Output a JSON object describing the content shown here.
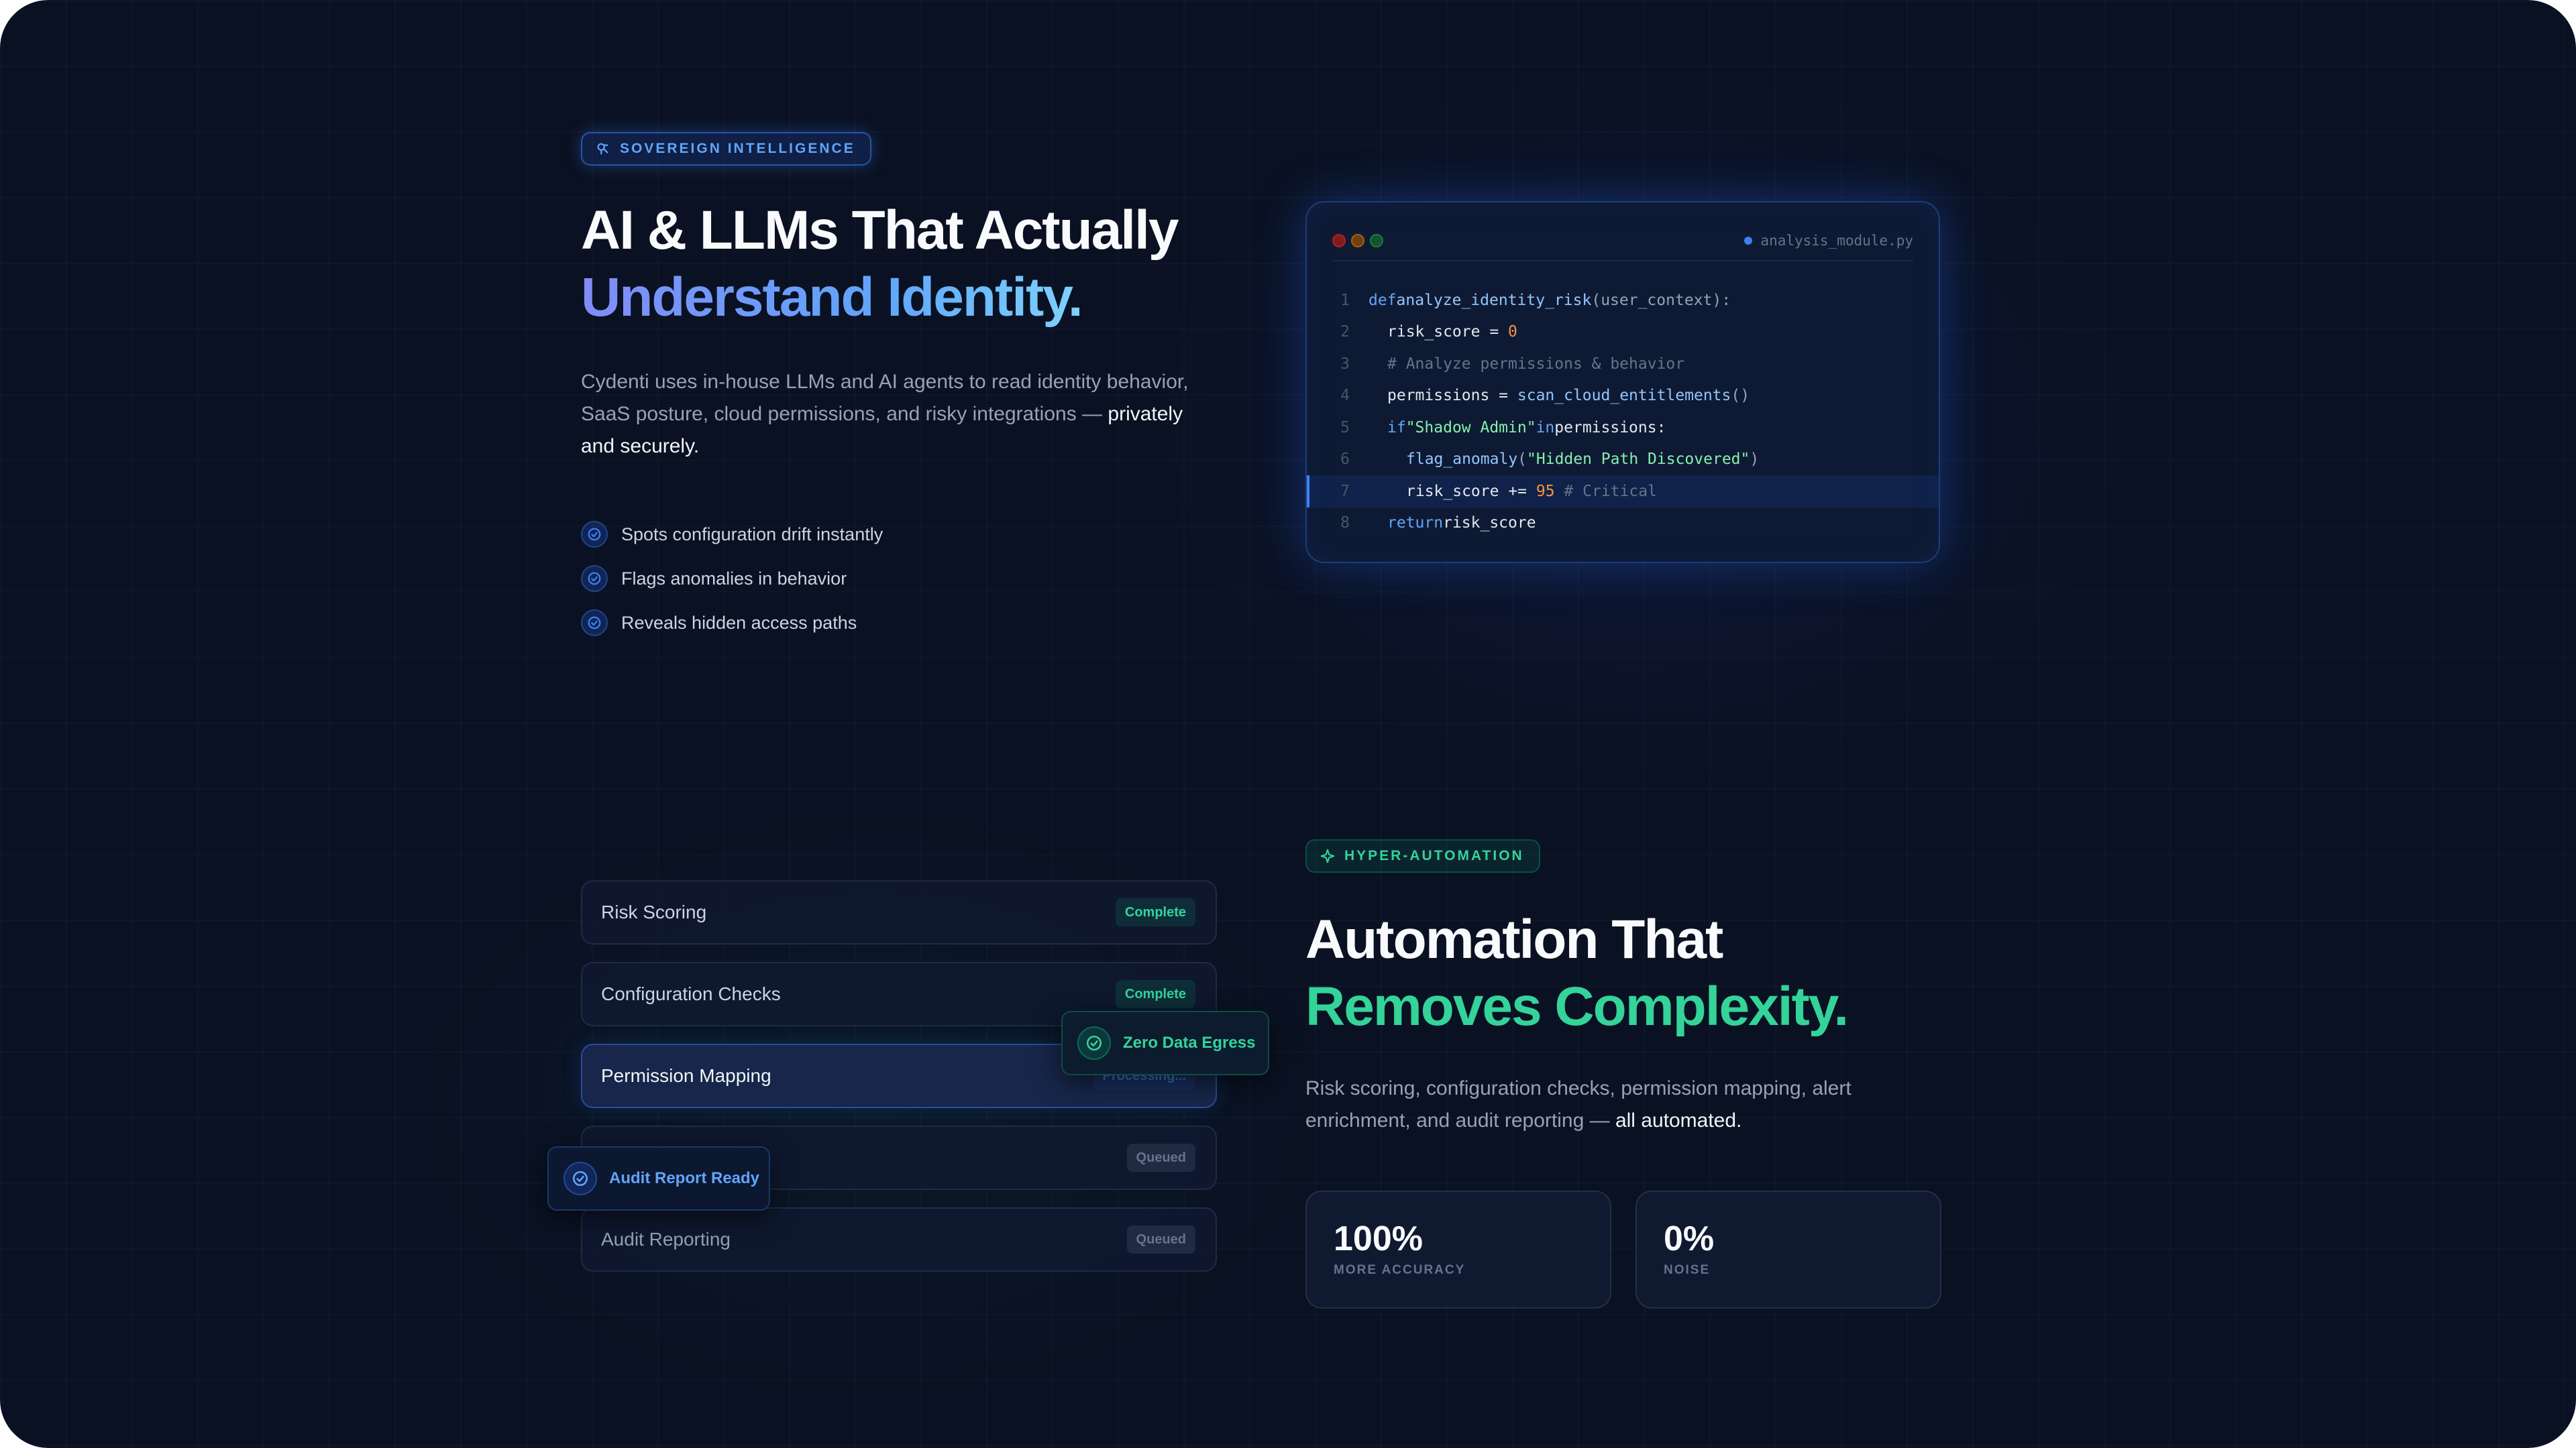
{
  "intelligence": {
    "badge": "Sovereign Intelligence",
    "heading_line1": "AI & LLMs That Actually",
    "heading_line2": "Understand Identity.",
    "description_start": "Cydenti uses in-house LLMs and AI agents to read identity behavior, SaaS posture, cloud permissions, and risky integrations — ",
    "description_emphasis": "privately and securely.",
    "checks": [
      "Spots configuration drift instantly",
      "Flags anomalies in behavior",
      "Reveals hidden access paths"
    ]
  },
  "code_window": {
    "filename": "analysis_module.py",
    "line_numbers": [
      "1",
      "2",
      "3",
      "4",
      "5",
      "6",
      "7",
      "8"
    ],
    "lines": {
      "l1_kw": "def",
      "l1_fn": "analyze_identity_risk",
      "l1_rest": "(user_context):",
      "l2_var": "risk_score = ",
      "l2_num": "0",
      "l3_comment": "# Analyze permissions & behavior",
      "l4_var": "permissions = ",
      "l4_fn": "scan_cloud_entitlements",
      "l4_rest": "()",
      "l5_kw": "if",
      "l5_str": "\"Shadow Admin\"",
      "l5_kw2": "in",
      "l5_rest": "permissions:",
      "l6_fn": "flag_anomaly",
      "l6_p1": "(",
      "l6_str": "\"Hidden Path Discovered\"",
      "l6_p2": ")",
      "l7_var": "risk_score += ",
      "l7_num": "95",
      "l7_comment": " # Critical",
      "l8_kw": "return",
      "l8_rest": "risk_score"
    }
  },
  "automation": {
    "badge": "Hyper-Automation",
    "heading_line1": "Automation That",
    "heading_line2": "Removes Complexity.",
    "description_start": "Risk scoring, configuration checks, permission mapping, alert enrichment, and audit reporting — ",
    "description_emphasis": "all automated.",
    "stats": [
      {
        "value": "100%",
        "label": "More Accuracy"
      },
      {
        "value": "0%",
        "label": "Noise"
      }
    ]
  },
  "pipeline": {
    "tasks": [
      {
        "name": "Risk Scoring",
        "status": "Complete"
      },
      {
        "name": "Configuration Checks",
        "status": "Complete"
      },
      {
        "name": "Permission Mapping",
        "status": "Processing..."
      },
      {
        "name": "",
        "status": "Queued"
      },
      {
        "name": "Audit Reporting",
        "status": "Queued"
      }
    ],
    "toast_egress": "Zero Data Egress",
    "toast_audit": "Audit Report Ready"
  },
  "colors": {
    "background": "#0a1122",
    "accent_blue": "#60a5fa",
    "accent_green": "#34d399"
  },
  "icons": {
    "badge_blue": "brain-icon",
    "badge_green": "sparkle-icon",
    "checks": "check-circle-icon",
    "toasts": "check-circle-icon"
  }
}
